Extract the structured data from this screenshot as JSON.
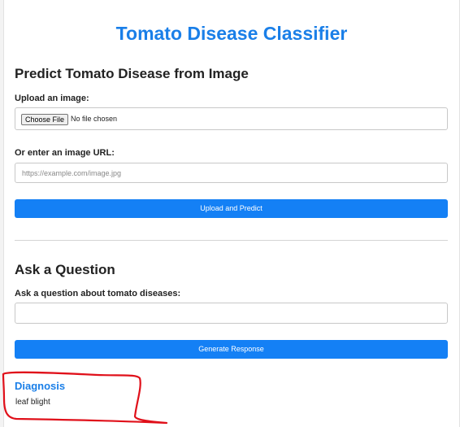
{
  "page": {
    "title": "Tomato Disease Classifier"
  },
  "predict_section": {
    "heading": "Predict Tomato Disease from Image",
    "upload_label": "Upload an image:",
    "file_button_label": "Choose File",
    "file_status": "No file chosen",
    "url_label": "Or enter an image URL:",
    "url_value": "",
    "url_placeholder": "https://example.com/image.jpg",
    "submit_label": "Upload and Predict"
  },
  "question_section": {
    "heading": "Ask a Question",
    "question_label": "Ask a question about tomato diseases:",
    "question_value": "",
    "submit_label": "Generate Response"
  },
  "diagnosis": {
    "heading": "Diagnosis",
    "result": "leaf blight"
  },
  "colors": {
    "accent": "#1a7fe8",
    "button": "#1480f5",
    "annotation": "#e0101a"
  }
}
